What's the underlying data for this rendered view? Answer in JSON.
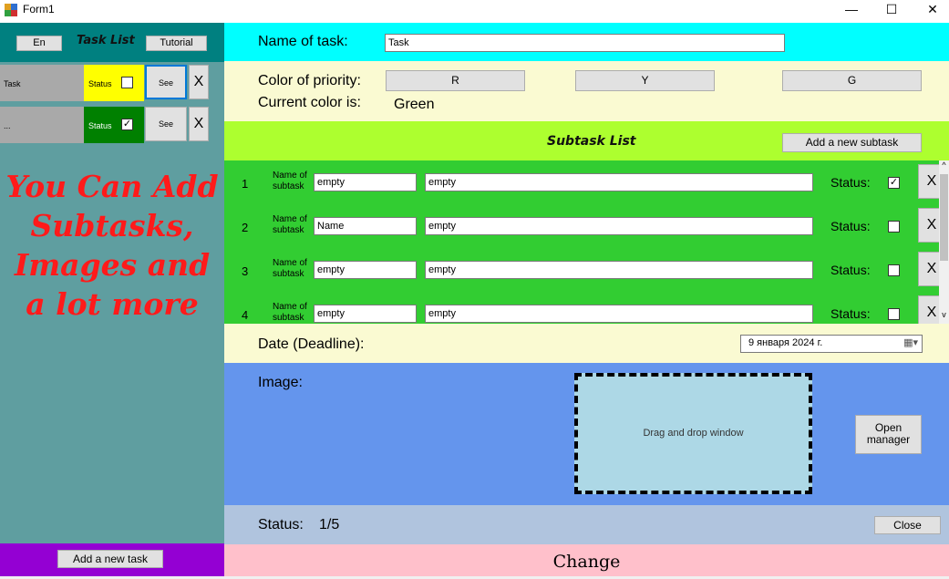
{
  "window": {
    "title": "Form1",
    "minimize": "—",
    "maximize": "☐",
    "close": "✕"
  },
  "left": {
    "lang_button": "En",
    "title": "Task List",
    "tutorial_button": "Tutorial",
    "tasks": [
      {
        "name": "Task",
        "status_label": "Status",
        "checked": false,
        "color": "#ffff00",
        "see": "See",
        "remove": "X"
      },
      {
        "name": "...",
        "status_label": "Status",
        "checked": true,
        "color": "#008000",
        "see": "See",
        "remove": "X"
      }
    ],
    "promo_lines": [
      "You Can Add",
      "Subtasks,",
      "Images and",
      "a lot more"
    ],
    "add_task_button": "Add a new task"
  },
  "task": {
    "name_label": "Name of task:",
    "name_value": "Task",
    "priority_label": "Color of priority:",
    "priority_buttons": [
      "R",
      "Y",
      "G"
    ],
    "current_color_label": "Current color is:",
    "current_color_value": "Green"
  },
  "subtasks": {
    "title": "Subtask List",
    "add_button": "Add a new subtask",
    "name_label_line1": "Name of",
    "name_label_line2": "subtask",
    "status_label": "Status:",
    "remove": "X",
    "rows": [
      {
        "num": "1",
        "name": "empty",
        "desc": "empty",
        "checked": true
      },
      {
        "num": "2",
        "name": "Name",
        "desc": "empty",
        "checked": false
      },
      {
        "num": "3",
        "name": "empty",
        "desc": "empty",
        "checked": false
      },
      {
        "num": "4",
        "name": "empty",
        "desc": "empty",
        "checked": false
      }
    ]
  },
  "deadline": {
    "label": "Date (Deadline):",
    "value": "9  января   2024 г."
  },
  "image": {
    "label": "Image:",
    "drop_text": "Drag and drop window",
    "open_button_line1": "Open",
    "open_button_line2": "manager"
  },
  "status": {
    "label": "Status:",
    "value": "1/5",
    "close_button": "Close"
  },
  "change_button": "Change",
  "colors": {
    "left_bg": "#5f9ea0",
    "left_header": "#008080",
    "left_footer": "#9400d3",
    "name_section": "#00ffff",
    "priority_section": "#fafad2",
    "subtask_header": "#adff2f",
    "subtask_body": "#32cd32",
    "image_section": "#6495ed",
    "status_section": "#b0c4de",
    "change_bg": "#ffc0cb",
    "promo_text": "#ff1a1a"
  }
}
